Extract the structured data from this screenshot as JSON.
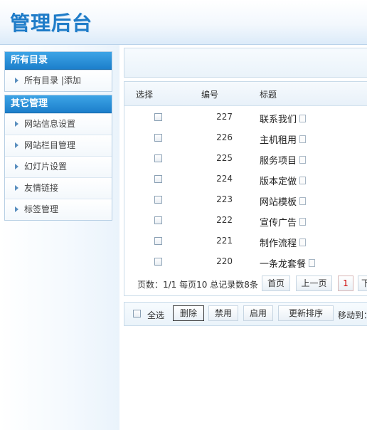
{
  "header": {
    "title": "管理后台"
  },
  "sidebar": {
    "panels": [
      {
        "title": "所有目录",
        "items": [
          {
            "label": "所有目录 |添加"
          }
        ]
      },
      {
        "title": "其它管理",
        "items": [
          {
            "label": "网站信息设置"
          },
          {
            "label": "网站栏目管理"
          },
          {
            "label": "幻灯片设置"
          },
          {
            "label": "友情链接"
          },
          {
            "label": "标签管理"
          }
        ]
      }
    ]
  },
  "table": {
    "headers": {
      "select": "选择",
      "id": "编号",
      "title": "标题"
    },
    "rows": [
      {
        "id": "227",
        "title": "联系我们"
      },
      {
        "id": "226",
        "title": "主机租用"
      },
      {
        "id": "225",
        "title": "服务项目"
      },
      {
        "id": "224",
        "title": "版本定做"
      },
      {
        "id": "223",
        "title": "网站模板"
      },
      {
        "id": "222",
        "title": "宣传广告"
      },
      {
        "id": "221",
        "title": "制作流程"
      },
      {
        "id": "220",
        "title": "一条龙套餐"
      }
    ]
  },
  "pager": {
    "info": "页数：1/1 每页10 总记录数8条",
    "first": "首页",
    "prev": "上一页",
    "current": "1",
    "next": "下"
  },
  "actions": {
    "select_all": "全选",
    "delete": "删除",
    "disable": "禁用",
    "enable": "启用",
    "reorder": "更新排序",
    "move_to": "移动到："
  },
  "colors": {
    "accent": "#1f7cc8",
    "panel_head": "#2a8fd6",
    "current_page": "#cc0000"
  }
}
